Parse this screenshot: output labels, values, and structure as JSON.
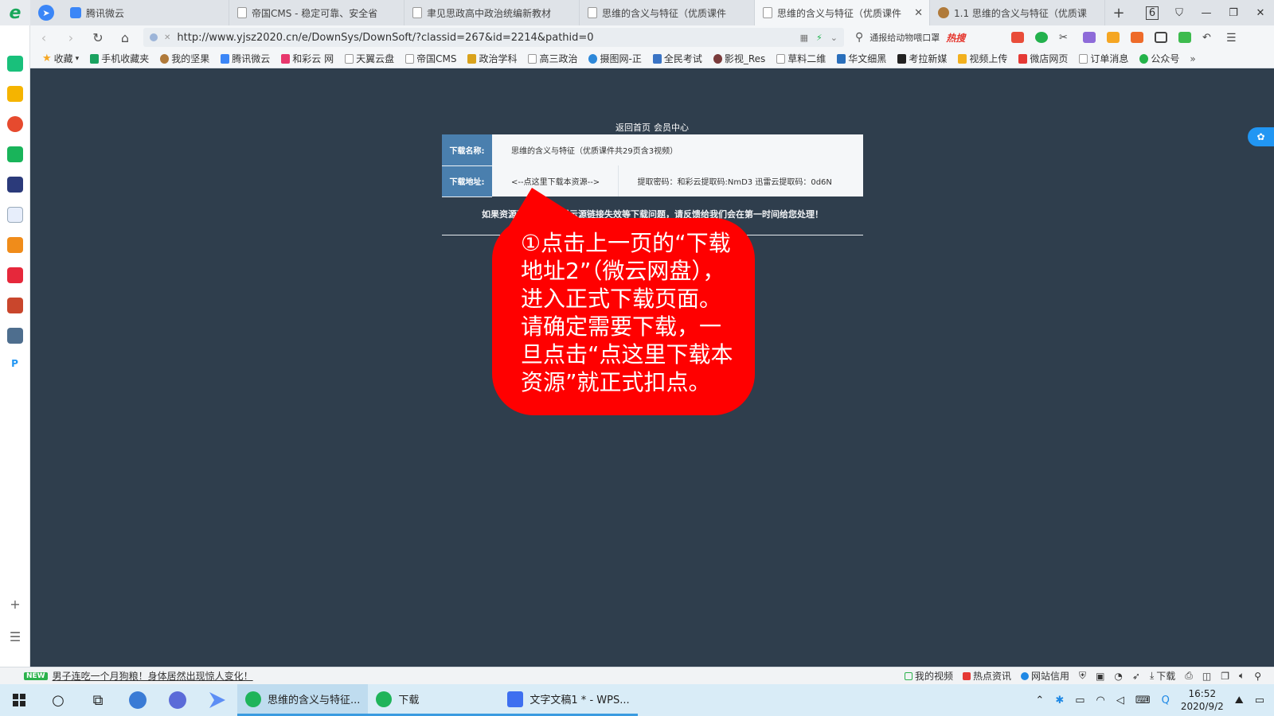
{
  "browser": {
    "tabs": [
      {
        "label": "腾讯微云",
        "icon": "cloud"
      },
      {
        "label": "帝国CMS - 稳定可靠、安全省",
        "icon": "page"
      },
      {
        "label": "聿见思政高中政治统编新教材",
        "icon": "page"
      },
      {
        "label": "思维的含义与特征（优质课件",
        "icon": "page"
      },
      {
        "label": "思维的含义与特征（优质课件",
        "icon": "page",
        "active": true
      },
      {
        "label": "1.1 思维的含义与特征（优质课",
        "icon": "nut"
      }
    ],
    "tab_count": "6",
    "url": "http://www.yjsz2020.cn/e/DownSys/DownSoft/?classid=267&id=2214&pathid=0",
    "search_hint": "通报给动物喂口罩",
    "hot_label": "热搜",
    "bookmarks": [
      "收藏",
      "手机收藏夹",
      "我的坚果",
      "腾讯微云",
      "和彩云 网",
      "天翼云盘",
      "帝国CMS",
      "政治学科",
      "高三政治",
      "摄图网-正",
      "全民考试",
      "影视_Res",
      "草料二维",
      "华文细黑",
      "考拉新媒",
      "视频上传",
      "微店网页",
      "订单消息",
      "公众号"
    ],
    "bookmarks_more": "»"
  },
  "page": {
    "top_links": [
      "返回首页",
      "会员中心"
    ],
    "download_name_label": "下载名称:",
    "download_name_value": "思维的含义与特征（优质课件共29页含3视频）",
    "download_addr_label": "下载地址:",
    "download_link_text": "<--点这里下载本资源-->",
    "extract_code_text": "提取密码：和彩云提取码:NmD3 迅雷云提取码：0d6N",
    "notice_text": "如果资源不能下载，提示源链接失效等下载问题，请反馈给我们会在第一时间给您处理！"
  },
  "callout": {
    "lines": [
      "①点击上一页的“下载",
      "地址2”（微云网盘），",
      "进入正式下载页面。",
      "请确定需要下载，一",
      "旦点击“点这里下载本",
      "资源”就正式扣点。"
    ],
    "color": "#ff0000"
  },
  "statusbar": {
    "new_badge": "NEW",
    "news_text": "男子连吃一个月狗粮！身体居然出现惊人变化！",
    "items": [
      "我的视频",
      "热点资讯",
      "网站信用",
      "下载"
    ]
  },
  "taskbar": {
    "apps": [
      {
        "label": "思维的含义与特征...",
        "active": true
      },
      {
        "label": "下载",
        "active": false
      },
      {
        "label": "文字文稿1 * - WPS...",
        "active": false
      }
    ],
    "time": "16:52",
    "date": "2020/9/2"
  },
  "colors": {
    "page_bg": "#2f3e4d",
    "label_blue": "#4a7fae",
    "callout_red": "#ff0000"
  }
}
